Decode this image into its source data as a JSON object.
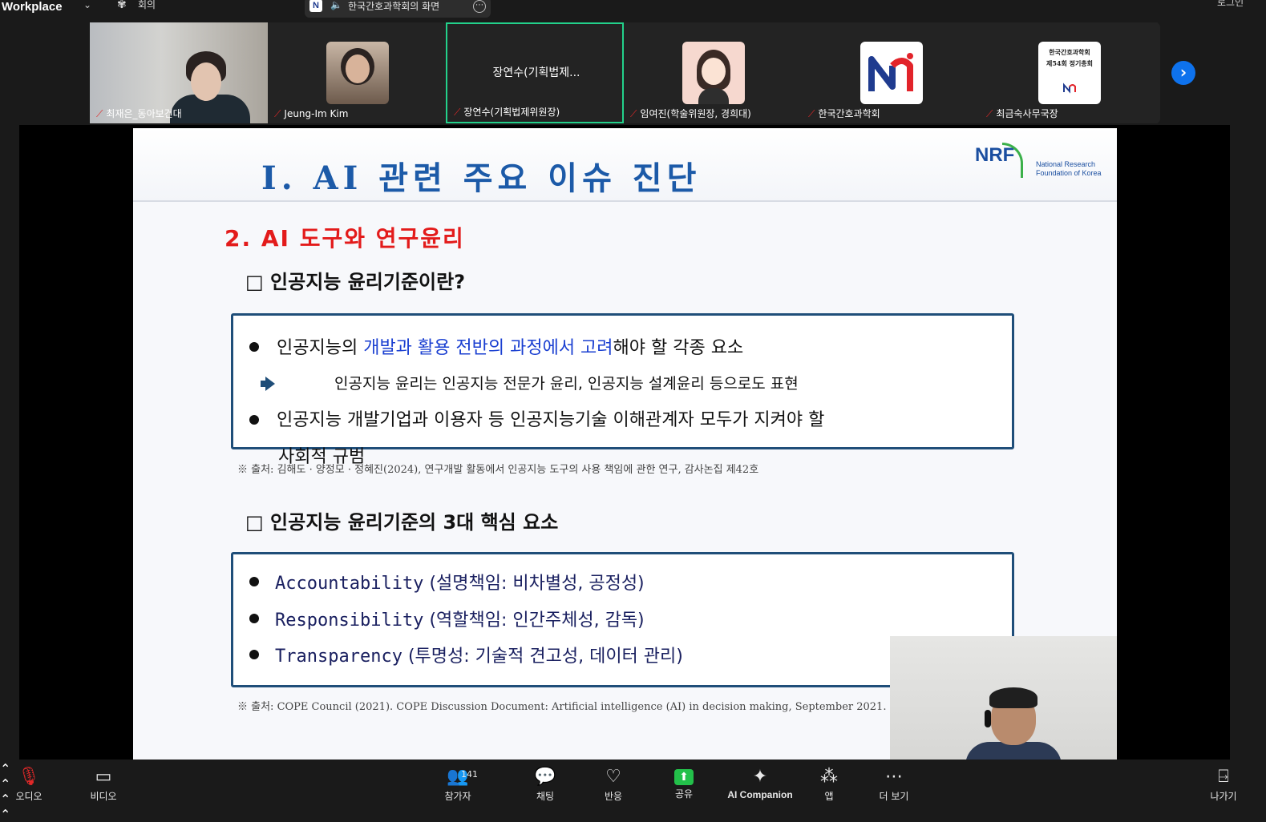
{
  "topbar": {
    "brand": "Workplace",
    "meeting_label": "회의",
    "share_title": "한국간호과학회의 화면",
    "logo_letter": "N",
    "right_label": "로그인"
  },
  "participants": [
    {
      "name": "최재은_동아보건대",
      "type": "video"
    },
    {
      "name": "Jeung-Im Kim",
      "type": "photo"
    },
    {
      "name": "장연수(기획법제위원장)",
      "type": "text",
      "display": "장연수(기획법제..."
    },
    {
      "name": "임여진(학술위원장, 경희대)",
      "type": "avatar"
    },
    {
      "name": "한국간호과학회",
      "type": "logo"
    },
    {
      "name": "최금숙사무국장",
      "type": "poster",
      "poster_lines": [
        "한국간호과학회",
        "제54회 정기총회"
      ]
    }
  ],
  "slide": {
    "title": "Ⅰ. AI 관련 주요 이슈 진단",
    "logo_text": "NRF",
    "logo_sub_1": "National Research",
    "logo_sub_2": "Foundation of Korea",
    "section": "2. AI 도구와 연구윤리",
    "q1": "□ 인공지능 윤리기준이란?",
    "box1": {
      "b1_pre": "인공지능의 ",
      "b1_blue": "개발과 활용 전반의 과정에서 고려",
      "b1_post": "해야 할 각종 요소",
      "sub": "인공지능 윤리는 인공지능 전문가 윤리, 인공지능 설계윤리 등으로도 표현",
      "b2": "인공지능 개발기업과 이용자 등 인공지능기술 이해관계자 모두가 지켜야 할",
      "b2_cont": "사회적 규범"
    },
    "cite1": "※ 출처: 김해도 · 양정모 · 정혜진(2024), 연구개발 활동에서 인공지능 도구의 사용 책임에 관한 연구, 감사논집 제42호",
    "q2": "□ 인공지능 윤리기준의 3대 핵심 요소",
    "box2": [
      {
        "en": "Accountability",
        "ko": "(설명책임: 비차별성, 공정성)"
      },
      {
        "en": "Responsibility",
        "ko": "(역할책임: 인간주체성, 감독)"
      },
      {
        "en": "Transparency",
        "ko": "(투명성: 기술적 견고성, 데이터 관리)"
      }
    ],
    "cite2": "※ 출처: COPE Council (2021). COPE Discussion Document: Artificial intelligence (AI) in decision making, September 2021."
  },
  "toolbar": {
    "audio": "오디오",
    "video": "비디오",
    "participants": "참가자",
    "participant_count": "141",
    "chat": "채팅",
    "reactions": "반응",
    "share": "공유",
    "ai": "AI Companion",
    "apps": "앱",
    "more": "더 보기",
    "leave": "나가기"
  },
  "colors": {
    "accent": "#0e72ed",
    "active_border": "#23d18b",
    "share_green": "#23c04a",
    "muted_red": "#e02828",
    "slide_title": "#1c5aa8",
    "section_red": "#e31b1b"
  }
}
